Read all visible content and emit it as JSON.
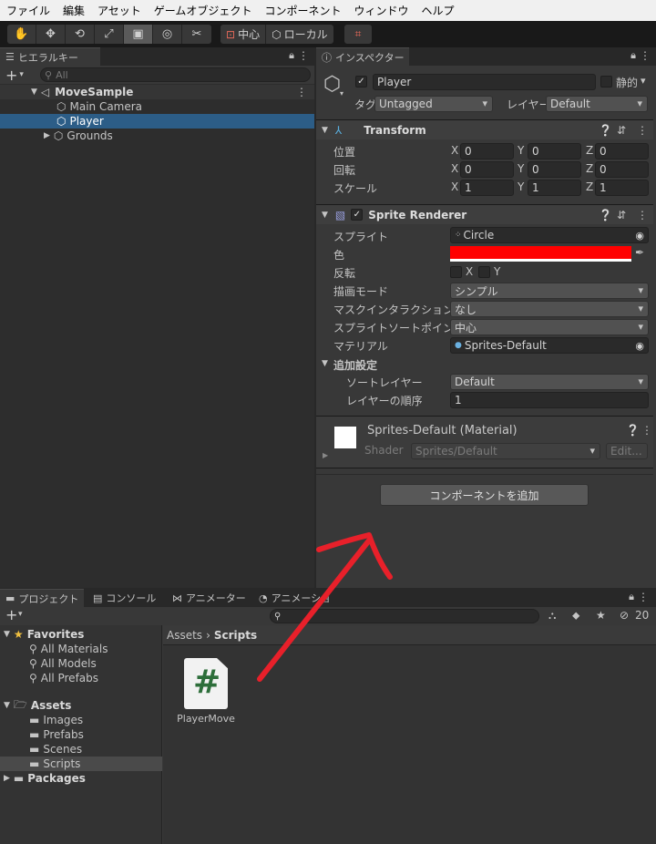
{
  "menu": [
    "ファイル",
    "編集",
    "アセット",
    "ゲームオブジェクト",
    "コンポーネント",
    "ウィンドウ",
    "ヘルプ"
  ],
  "toolbar": {
    "pivot_label": "中心",
    "space_label": "ローカル"
  },
  "hierarchy": {
    "tab": "ヒエラルキー",
    "search_placeholder": "All",
    "scene": "MoveSample",
    "items": [
      "Main Camera",
      "Player",
      "Grounds"
    ]
  },
  "inspector": {
    "tab": "インスペクター",
    "object_name": "Player",
    "static_label": "静的",
    "tag_label": "タグ",
    "tag_value": "Untagged",
    "layer_label": "レイヤー",
    "layer_value": "Default",
    "transform": {
      "title": "Transform",
      "position_label": "位置",
      "rotation_label": "回転",
      "scale_label": "スケール",
      "axis_x": "X",
      "axis_y": "Y",
      "axis_z": "Z",
      "position": [
        "0",
        "0",
        "0"
      ],
      "rotation": [
        "0",
        "0",
        "0"
      ],
      "scale": [
        "1",
        "1",
        "1"
      ]
    },
    "sprite_renderer": {
      "title": "Sprite Renderer",
      "sprite_label": "スプライト",
      "sprite_value": "Circle",
      "color_label": "色",
      "color_value": "#ff0000",
      "flip_label": "反転",
      "flip_x": "X",
      "flip_y": "Y",
      "draw_mode_label": "描画モード",
      "draw_mode_value": "シンプル",
      "mask_label": "マスクインタラクション",
      "mask_value": "なし",
      "sort_point_label": "スプライトソートポイント",
      "sort_point_value": "中心",
      "material_label": "マテリアル",
      "material_value": "Sprites-Default",
      "additional_label": "追加設定",
      "sort_layer_label": "ソートレイヤー",
      "sort_layer_value": "Default",
      "order_label": "レイヤーの順序",
      "order_value": "1"
    },
    "material": {
      "title": "Sprites-Default (Material)",
      "shader_label": "Shader",
      "shader_value": "Sprites/Default",
      "edit_label": "Edit..."
    },
    "add_component": "コンポーネントを追加"
  },
  "bottom_tabs": [
    "プロジェクト",
    "コンソール",
    "アニメーター",
    "アニメーション"
  ],
  "project": {
    "count": "20",
    "favorites_label": "Favorites",
    "favorites": [
      "All Materials",
      "All Models",
      "All Prefabs"
    ],
    "assets_label": "Assets",
    "assets": [
      "Images",
      "Prefabs",
      "Scenes",
      "Scripts"
    ],
    "packages_label": "Packages",
    "breadcrumb_root": "Assets",
    "breadcrumb_current": "Scripts",
    "file_name": "PlayerMove",
    "file_glyph": "#"
  },
  "colors": {
    "accent_select": "#2c5d87",
    "annotation_arrow": "#e8202a",
    "script_green": "#2d6e3a"
  }
}
